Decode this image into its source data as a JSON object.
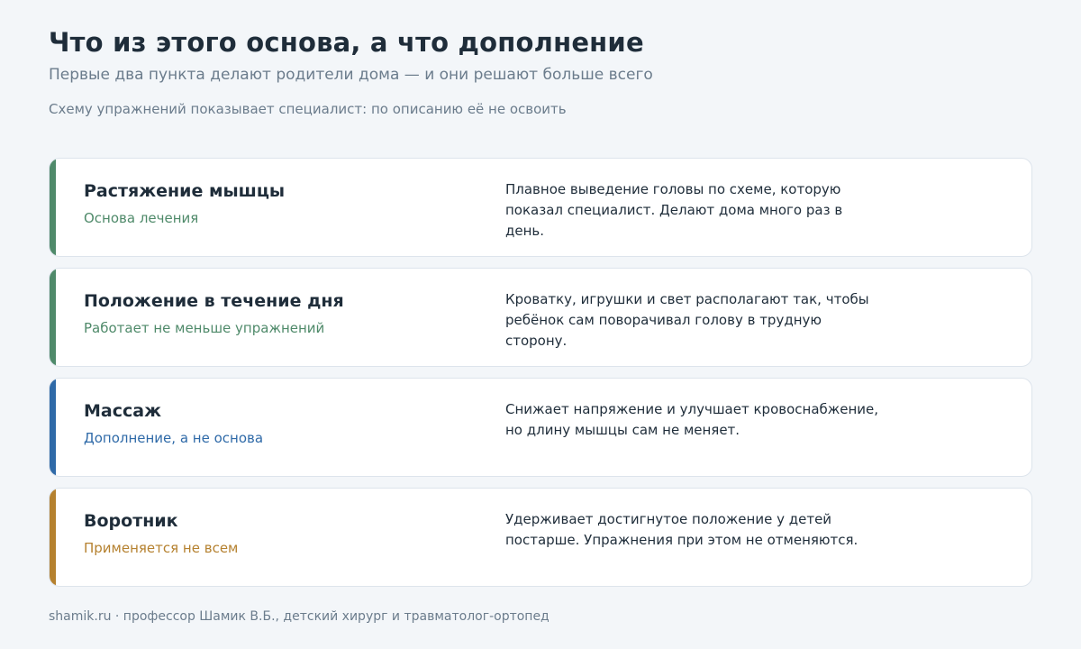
{
  "header": {
    "title": "Что из этого основа, а что дополнение",
    "subtitle": "Первые два пункта делают родители дома — и они решают больше всего",
    "note": "Схему упражнений показывает специалист: по описанию её не освоить"
  },
  "cards": [
    {
      "name": "Растяжение мышцы",
      "role": "Основа лечения",
      "description": "Плавное выведение головы по схеме, которую показал специалист. Делают дома много раз в день.",
      "accent": "#4f8a6a"
    },
    {
      "name": "Положение в течение дня",
      "role": "Работает не меньше упражнений",
      "description": "Кроватку, игрушки и свет располагают так, чтобы ребёнок сам поворачивал голову в трудную сторону.",
      "accent": "#4f8a6a"
    },
    {
      "name": "Массаж",
      "role": "Дополнение, а не основа",
      "description": "Снижает напряжение и улучшает кровоснабжение, но длину мышцы сам не меняет.",
      "accent": "#2f6aa8"
    },
    {
      "name": "Воротник",
      "role": "Применяется не всем",
      "description": "Удерживает достигнутое положение у детей постарше. Упражнения при этом не отменяются.",
      "accent": "#b5812f"
    }
  ],
  "footer": {
    "text": "shamik.ru · профессор Шамик В.Б., детский хирург и травматолог-ортопед"
  }
}
